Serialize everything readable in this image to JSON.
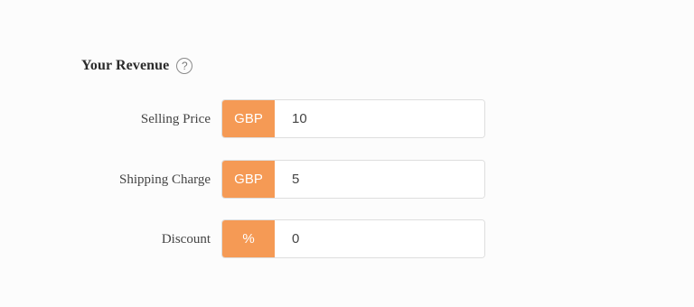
{
  "revenue": {
    "title": "Your Revenue",
    "help_glyph": "?",
    "fields": [
      {
        "label": "Selling Price",
        "addon": "GBP",
        "value": "10"
      },
      {
        "label": "Shipping Charge",
        "addon": "GBP",
        "value": "5"
      },
      {
        "label": "Discount",
        "addon": "%",
        "value": "0"
      }
    ]
  },
  "colors": {
    "addon_background": "#f59a55",
    "addon_text": "#ffffff",
    "input_border": "#dedede",
    "page_background": "#fcfcfc"
  },
  "icons": {
    "help": "question-circle-icon"
  }
}
